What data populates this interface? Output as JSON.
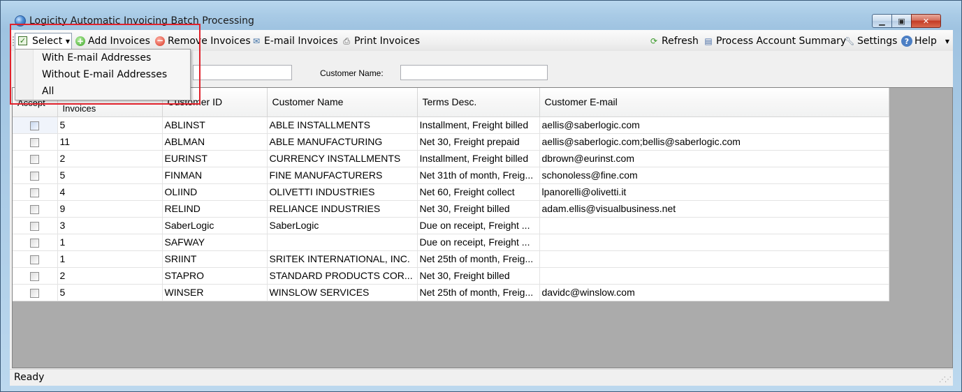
{
  "window": {
    "title": "Logicity Automatic Invoicing Batch Processing",
    "minimize": "▁",
    "maximize": "▣",
    "close": "✕"
  },
  "toolbar": {
    "select_label": "Select",
    "add_invoices": "Add Invoices",
    "remove_invoices": "Remove Invoices",
    "email_invoices": "E-mail Invoices",
    "print_invoices": "Print Invoices",
    "refresh": "Refresh",
    "process_account_summary": "Process Account Summary",
    "settings": "Settings",
    "help": "Help"
  },
  "select_menu": {
    "items": [
      "With E-mail Addresses",
      "Without E-mail Addresses",
      "All"
    ]
  },
  "filter": {
    "customer_name_label": "Customer Name:",
    "customer_id_value": "",
    "customer_name_value": ""
  },
  "grid": {
    "columns": [
      "Accept",
      "Invoices",
      "Customer ID",
      "Customer Name",
      "Terms Desc.",
      "Customer E-mail"
    ],
    "rows": [
      {
        "invoices": "5",
        "customer_id": "ABLINST",
        "customer_name": "ABLE INSTALLMENTS",
        "terms": "Installment, Freight billed",
        "email": "aellis@saberlogic.com"
      },
      {
        "invoices": "11",
        "customer_id": "ABLMAN",
        "customer_name": "ABLE MANUFACTURING",
        "terms": "Net 30, Freight prepaid",
        "email": "aellis@saberlogic.com;bellis@saberlogic.com"
      },
      {
        "invoices": "2",
        "customer_id": "EURINST",
        "customer_name": "CURRENCY INSTALLMENTS",
        "terms": "Installment, Freight billed",
        "email": "dbrown@eurinst.com"
      },
      {
        "invoices": "5",
        "customer_id": "FINMAN",
        "customer_name": "FINE MANUFACTURERS",
        "terms": "Net 31th of month, Freig...",
        "email": "schonoless@fine.com"
      },
      {
        "invoices": "4",
        "customer_id": "OLIIND",
        "customer_name": "OLIVETTI INDUSTRIES",
        "terms": "Net 60, Freight collect",
        "email": "lpanorelli@olivetti.it"
      },
      {
        "invoices": "9",
        "customer_id": "RELIND",
        "customer_name": "RELIANCE INDUSTRIES",
        "terms": "Net 30, Freight billed",
        "email": "adam.ellis@visualbusiness.net"
      },
      {
        "invoices": "3",
        "customer_id": "SaberLogic",
        "customer_name": "SaberLogic",
        "terms": "Due on receipt, Freight ...",
        "email": ""
      },
      {
        "invoices": "1",
        "customer_id": "SAFWAY",
        "customer_name": "",
        "terms": "Due on receipt, Freight ...",
        "email": ""
      },
      {
        "invoices": "1",
        "customer_id": "SRIINT",
        "customer_name": "SRITEK INTERNATIONAL, INC.",
        "terms": "Net 25th of month, Freig...",
        "email": ""
      },
      {
        "invoices": "2",
        "customer_id": "STAPRO",
        "customer_name": "STANDARD PRODUCTS COR...",
        "terms": "Net 30, Freight billed",
        "email": ""
      },
      {
        "invoices": "5",
        "customer_id": "WINSER",
        "customer_name": "WINSLOW SERVICES",
        "terms": "Net 25th of month, Freig...",
        "email": "davidc@winslow.com"
      }
    ]
  },
  "status": {
    "text": "Ready"
  },
  "colors": {
    "highlight_box": "#e0222c",
    "window_frame": "#a9cbe6"
  }
}
